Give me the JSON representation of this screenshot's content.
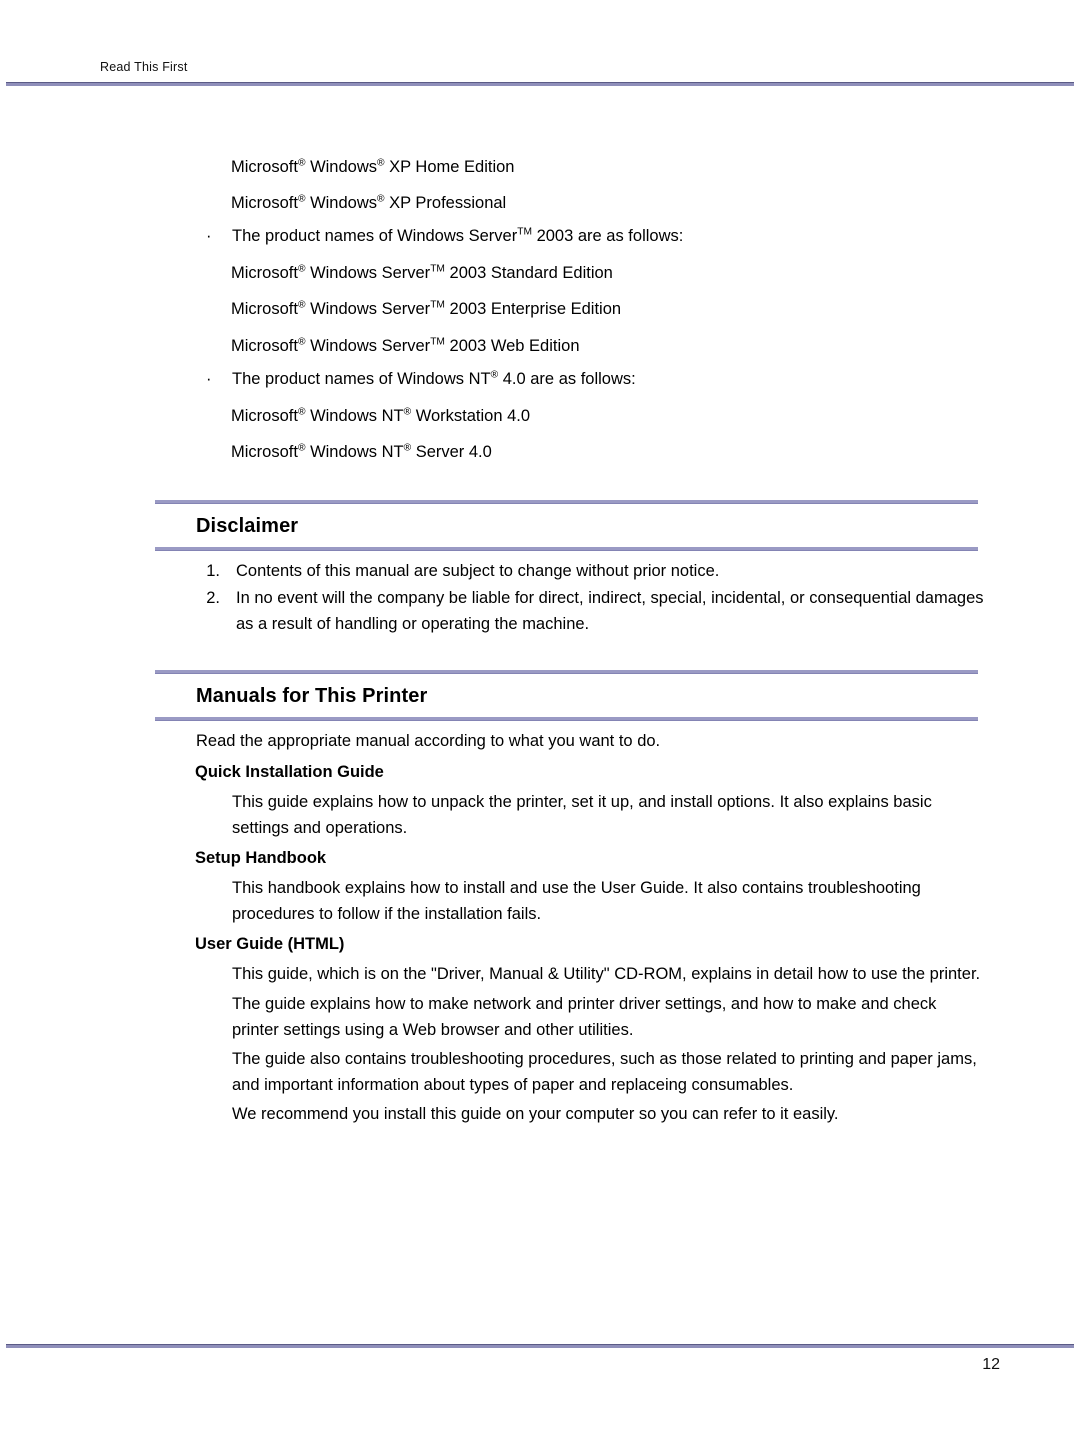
{
  "header": {
    "running_title": "Read This First",
    "rule_color": "#8f8fba"
  },
  "footer": {
    "page_number": "12",
    "rule_color": "#8f8fba"
  },
  "theme": {
    "heading_rule_color": "#9a9ac4",
    "text_color": "#000000",
    "background": "#ffffff"
  },
  "product_names": {
    "xp_home": {
      "microsoft": "Microsoft",
      "windows": "Windows",
      "tail": "XP Home Edition"
    },
    "xp_pro": {
      "microsoft": "Microsoft",
      "windows": "Windows",
      "tail": "XP Professional"
    },
    "server_bullet": {
      "bullet": "·",
      "lead": "The product names of Windows Server",
      "tail": "2003 are as follows:"
    },
    "server_standard": {
      "microsoft": "Microsoft",
      "windows_server": "Windows Server",
      "tail": "2003 Standard Edition"
    },
    "server_enterprise": {
      "microsoft": "Microsoft",
      "windows_server": "Windows Server",
      "tail": "2003 Enterprise Edition"
    },
    "server_web": {
      "microsoft": "Microsoft",
      "windows_server": "Windows Server",
      "tail": "2003 Web Edition"
    },
    "nt_bullet": {
      "bullet": "·",
      "lead": "The product names of Windows NT",
      "tail": "4.0 are as follows:"
    },
    "nt_workstation": {
      "microsoft": "Microsoft",
      "windows_nt": "Windows NT",
      "tail": "Workstation 4.0"
    },
    "nt_server": {
      "microsoft": "Microsoft",
      "windows_nt": "Windows NT",
      "tail": "Server 4.0"
    },
    "registered_mark": "®",
    "trademark_mark": "TM"
  },
  "disclaimer": {
    "heading": "Disclaimer",
    "items": [
      {
        "number": "1.",
        "text": "Contents of this manual are subject to change without prior notice."
      },
      {
        "number": "2.",
        "text": "In no event will the company be liable for direct, indirect, special, incidental, or consequential damages as a result of handling or operating the machine."
      }
    ]
  },
  "manuals": {
    "heading": "Manuals for This Printer",
    "intro": "Read the appropriate manual according to what you want to do.",
    "sections": [
      {
        "title": "Quick Installation Guide",
        "paragraphs": [
          "This guide explains how to unpack the printer, set it up, and install options. It also explains basic settings and operations."
        ]
      },
      {
        "title": "Setup Handbook",
        "paragraphs": [
          "This handbook explains how to install and use the User Guide. It also contains troubleshooting procedures to follow if the installation fails."
        ]
      },
      {
        "title": "User Guide (HTML)",
        "paragraphs": [
          "This guide, which is on the \"Driver, Manual & Utility\" CD-ROM, explains in detail how to use the printer.",
          "The guide explains how to make network and printer driver settings, and how to make and check printer settings using a Web browser and other utilities.",
          "The guide also contains troubleshooting procedures, such as those related to printing and paper jams, and important information about types of paper and replaceing consumables.",
          "We recommend you install this guide on your computer so you can refer to it easily."
        ]
      }
    ]
  }
}
